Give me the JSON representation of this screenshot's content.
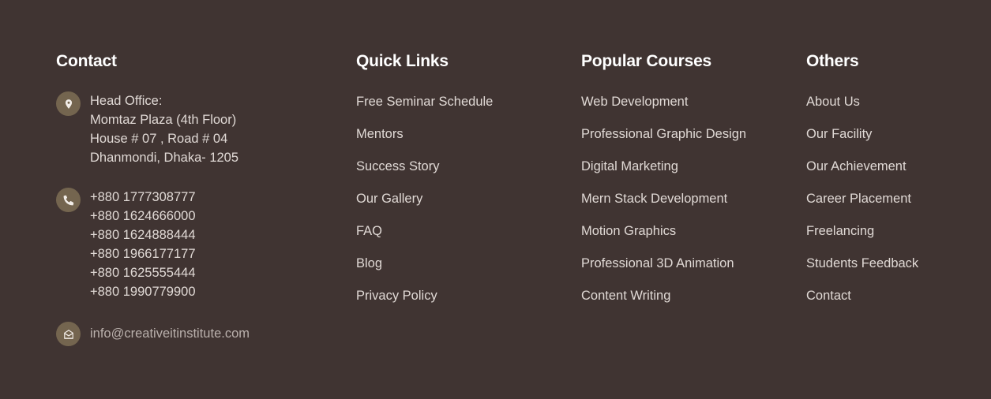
{
  "colors": {
    "background": "#403432",
    "heading": "#ffffff",
    "text": "#e0d9d5",
    "icon_circle": "#74654f"
  },
  "contact": {
    "heading": "Contact",
    "address": {
      "icon": "location-pin-icon",
      "lines": [
        "Head Office:",
        "Momtaz Plaza (4th Floor)",
        "House # 07 , Road # 04",
        "Dhanmondi, Dhaka- 1205"
      ]
    },
    "phones": {
      "icon": "phone-icon",
      "numbers": [
        "+880 1777308777",
        "+880 1624666000",
        "+880 1624888444",
        "+880 1966177177",
        "+880 1625555444",
        "+880 1990779900"
      ]
    },
    "email": {
      "icon": "envelope-open-icon",
      "address": "info@creativeitinstitute.com"
    }
  },
  "quick_links": {
    "heading": "Quick Links",
    "items": [
      "Free Seminar Schedule",
      "Mentors",
      "Success Story",
      "Our Gallery",
      "FAQ",
      "Blog",
      "Privacy Policy"
    ]
  },
  "popular_courses": {
    "heading": "Popular Courses",
    "items": [
      "Web Development",
      "Professional Graphic Design",
      "Digital Marketing",
      "Mern Stack Development",
      "Motion Graphics",
      "Professional 3D Animation",
      "Content Writing"
    ]
  },
  "others": {
    "heading": "Others",
    "items": [
      "About Us",
      "Our Facility",
      "Our Achievement",
      "Career Placement",
      "Freelancing",
      "Students Feedback",
      "Contact"
    ]
  }
}
